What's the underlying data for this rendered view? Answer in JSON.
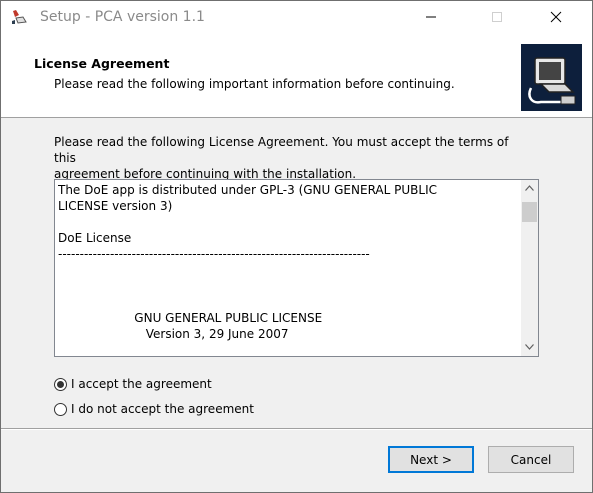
{
  "window": {
    "title": "Setup - PCA version 1.1",
    "icon": "setup-app-icon",
    "controls": [
      "minimize-icon",
      "maximize-icon",
      "close-icon"
    ]
  },
  "header": {
    "title": "License Agreement",
    "subtitle": "Please read the following important information before continuing.",
    "image": "computer-installer-image"
  },
  "intro": {
    "line1": "Please read the following License Agreement. You must accept the terms of this",
    "line2": "agreement before continuing with the installation."
  },
  "license_memo": {
    "lines": [
      "The DoE app is distributed under GPL-3 (GNU GENERAL PUBLIC",
      "LICENSE version 3)",
      "",
      "DoE License",
      "------------------------------------------------------------------------",
      "",
      "",
      "",
      "                    GNU GENERAL PUBLIC LICENSE",
      "                       Version 3, 29 June 2007"
    ]
  },
  "options": {
    "accept": {
      "label": "I accept the agreement",
      "checked": true
    },
    "decline": {
      "label": "I do not accept the agreement",
      "checked": false
    }
  },
  "buttons": {
    "next": "Next >",
    "cancel": "Cancel"
  },
  "colors": {
    "accent": "#0078d7",
    "header_bg": "#ffffff",
    "body_bg": "#f0f0f0",
    "wizard_image_bg": "#0d1f3c"
  }
}
